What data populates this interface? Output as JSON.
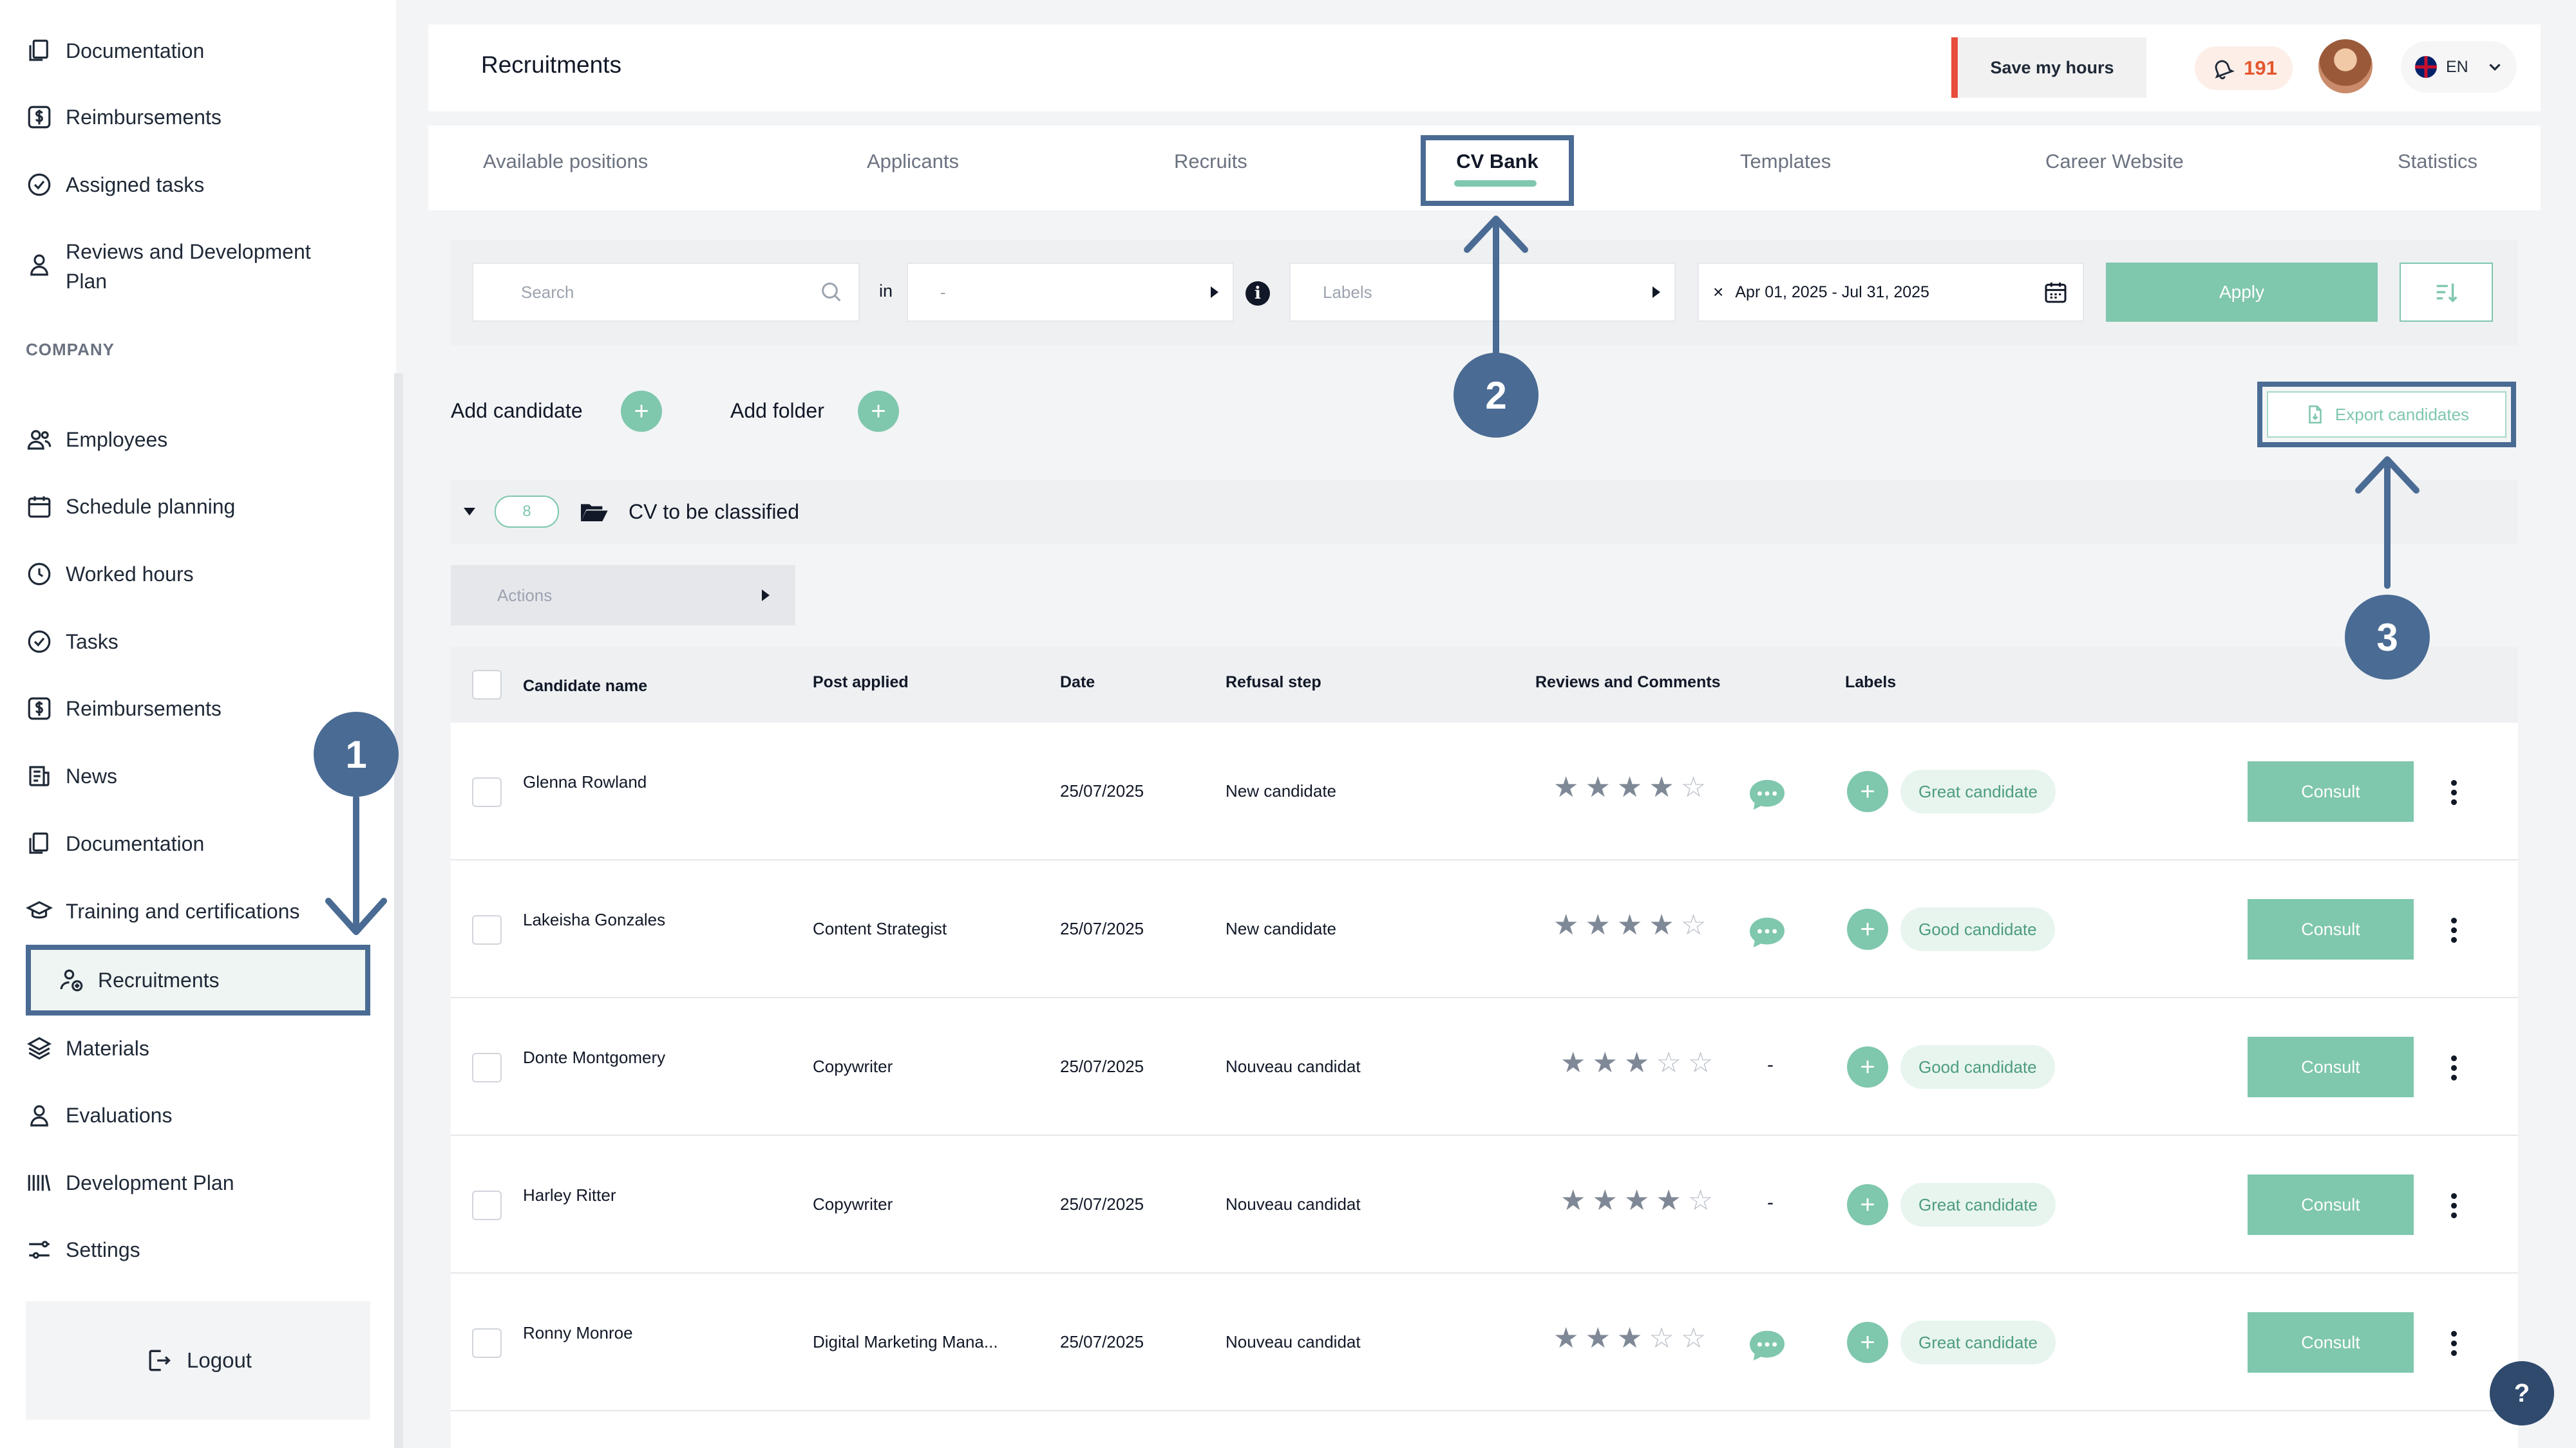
{
  "sidebar": {
    "items_top": [
      {
        "label": "Documentation",
        "icon": "documents-icon"
      },
      {
        "label": "Reimbursements",
        "icon": "dollar-icon"
      },
      {
        "label": "Assigned tasks",
        "icon": "check-circle-icon"
      },
      {
        "label": "Reviews and Development Plan",
        "label_line1": "Reviews and Development",
        "label_line2": "Plan",
        "icon": "person-icon"
      }
    ],
    "section_title": "COMPANY",
    "items_company": [
      {
        "label": "Employees",
        "icon": "users-icon"
      },
      {
        "label": "Schedule planning",
        "icon": "calendar-icon"
      },
      {
        "label": "Worked hours",
        "icon": "clock-icon"
      },
      {
        "label": "Tasks",
        "icon": "check-circle-icon"
      },
      {
        "label": "Reimbursements",
        "icon": "dollar-icon"
      },
      {
        "label": "News",
        "icon": "news-icon"
      },
      {
        "label": "Documentation",
        "icon": "documents-icon"
      },
      {
        "label": "Training and certifications",
        "icon": "graduation-cap-icon"
      },
      {
        "label": "Recruitments",
        "icon": "recruit-icon",
        "active": true
      },
      {
        "label": "Materials",
        "icon": "layers-icon"
      },
      {
        "label": "Evaluations",
        "icon": "person-icon"
      },
      {
        "label": "Development Plan",
        "icon": "bars-icon"
      },
      {
        "label": "Settings",
        "icon": "sliders-icon"
      }
    ],
    "logout_label": "Logout"
  },
  "header": {
    "title": "Recruitments",
    "save_hours_label": "Save my hours",
    "notification_count": "191",
    "language": "EN"
  },
  "tabs": {
    "items": [
      "Available positions",
      "Applicants",
      "Recruits",
      "CV Bank",
      "Templates",
      "Career Website",
      "Statistics"
    ],
    "active": "CV Bank"
  },
  "filters": {
    "search_placeholder": "Search",
    "in_label": "in",
    "in_value": "-",
    "labels_placeholder": "Labels",
    "date_range": "Apr 01, 2025 - Jul 31, 2025",
    "apply_label": "Apply"
  },
  "actions": {
    "add_candidate_label": "Add candidate",
    "add_folder_label": "Add folder",
    "export_label": "Export candidates"
  },
  "folder": {
    "count": "8",
    "name": "CV to be classified",
    "actions_placeholder": "Actions"
  },
  "table": {
    "headers": {
      "name": "Candidate name",
      "post": "Post applied",
      "date": "Date",
      "refusal": "Refusal step",
      "reviews": "Reviews and Comments",
      "labels": "Labels"
    },
    "rows": [
      {
        "name": "Glenna Rowland",
        "post": "",
        "date": "25/07/2025",
        "refusal_step": "New candidate",
        "rating": 4,
        "has_comments": true,
        "comment_text": "",
        "label": "Great candidate",
        "action": "Consult"
      },
      {
        "name": "Lakeisha Gonzales",
        "post": "Content Strategist",
        "date": "25/07/2025",
        "refusal_step": "New candidate",
        "rating": 4,
        "has_comments": true,
        "comment_text": "",
        "label": "Good candidate",
        "action": "Consult"
      },
      {
        "name": "Donte Montgomery",
        "post": "Copywriter",
        "date": "25/07/2025",
        "refusal_step": "Nouveau candidat",
        "rating": 3,
        "has_comments": false,
        "comment_text": "-",
        "label": "Good candidate",
        "action": "Consult"
      },
      {
        "name": "Harley Ritter",
        "post": "Copywriter",
        "date": "25/07/2025",
        "refusal_step": "Nouveau candidat",
        "rating": 4,
        "has_comments": false,
        "comment_text": "-",
        "label": "Great candidate",
        "action": "Consult"
      },
      {
        "name": "Ronny Monroe",
        "post": "Digital Marketing Mana...",
        "date": "25/07/2025",
        "refusal_step": "Nouveau candidat",
        "rating": 3,
        "has_comments": true,
        "comment_text": "",
        "label": "Great candidate",
        "action": "Consult"
      }
    ]
  },
  "callouts": [
    "1",
    "2",
    "3"
  ],
  "help_label": "?",
  "colors": {
    "accent": "#7fc7ad",
    "callout": "#4a6b93",
    "alert": "#e74c3c",
    "notification": "#e4572e"
  }
}
